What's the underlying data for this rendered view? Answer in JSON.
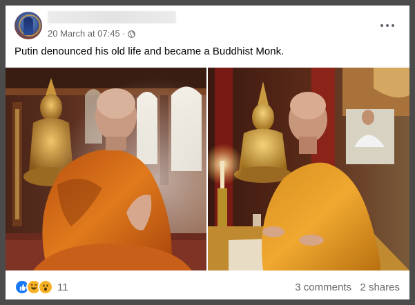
{
  "post": {
    "timestamp": "20 March at 07:45",
    "separator": "·",
    "caption": "Putin denounced his old life and became a Buddhist Monk.",
    "images": [
      {
        "icon": "monk-photo-meditating",
        "description_hidden": ""
      },
      {
        "icon": "monk-photo-reading",
        "description_hidden": ""
      }
    ]
  },
  "footer": {
    "reactions": [
      "like-icon",
      "haha-icon",
      "wow-icon"
    ],
    "reaction_count": "11",
    "comments": "3 comments",
    "shares": "2 shares"
  },
  "colors": {
    "background": "#4b4b4b",
    "card": "#ffffff",
    "meta_text": "#65676b",
    "like_blue": "#1877f2",
    "robe_orange": "#e08a1e"
  }
}
